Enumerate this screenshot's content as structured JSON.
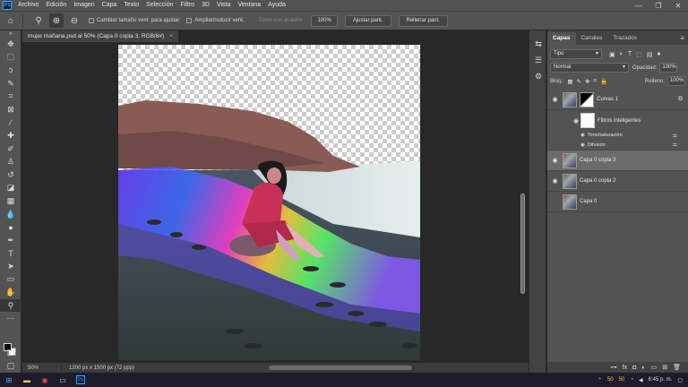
{
  "app": {
    "logo": "Ps"
  },
  "menu": [
    "Archivo",
    "Edición",
    "Imagen",
    "Capa",
    "Texto",
    "Selección",
    "Filtro",
    "3D",
    "Vista",
    "Ventana",
    "Ayuda"
  ],
  "window_controls": [
    "—",
    "❐",
    "✕"
  ],
  "options": {
    "resize_windows_label": "Cambiar tamaño vent. para ajustar",
    "zoom_all_label": "Ampliar/reducir vent.",
    "scrubby_label": "Zoom con arrastre",
    "zoom_value": "100%",
    "fit_screen_label": "Ajustar pant.",
    "fill_screen_label": "Rellenar pant."
  },
  "document": {
    "tab_title": "mujer mañana.psd al 50% (Capa 0 copia 3, RGB/8#)",
    "tab_close": "×",
    "status_zoom": "50%",
    "status_info": "1200 px x 1500 px (72 ppp)"
  },
  "layers_panel": {
    "tabs": [
      "Capas",
      "Canales",
      "Trazados"
    ],
    "kind_label": "Tipo",
    "blend_mode": "Normal",
    "opacity_label": "Opacidad:",
    "opacity_value": "100%",
    "lock_label": "Bloq.:",
    "fill_label": "Relleno:",
    "fill_value": "100%",
    "layers": [
      {
        "name": "Curvas 1"
      },
      {
        "name": "Filtros inteligentes"
      },
      {
        "name": "Tono/saturación"
      },
      {
        "name": "Difusión"
      },
      {
        "name": "Capa 0 copia 3"
      },
      {
        "name": "Capa 0 copia 2"
      },
      {
        "name": "Capa 0"
      }
    ]
  },
  "taskbar": {
    "num_a": "50",
    "num_b": "50",
    "time": "6:45 p. m."
  }
}
